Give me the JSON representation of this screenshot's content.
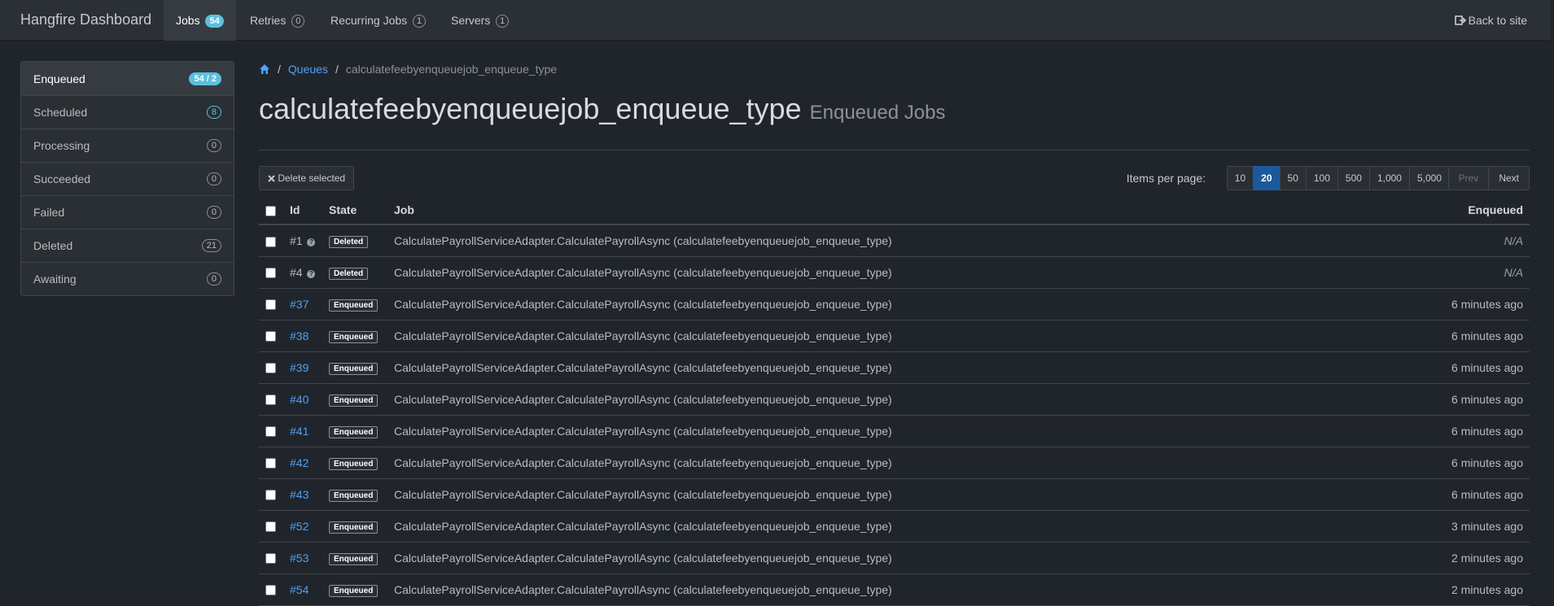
{
  "nav": {
    "brand": "Hangfire Dashboard",
    "items": [
      {
        "label": "Jobs",
        "count": "54"
      },
      {
        "label": "Retries",
        "count": "0"
      },
      {
        "label": "Recurring Jobs",
        "count": "1"
      },
      {
        "label": "Servers",
        "count": "1"
      }
    ],
    "back_label": "Back to site"
  },
  "sidebar": {
    "items": [
      {
        "label": "Enqueued",
        "count": "54 / 2"
      },
      {
        "label": "Scheduled",
        "count": "8"
      },
      {
        "label": "Processing",
        "count": "0"
      },
      {
        "label": "Succeeded",
        "count": "0"
      },
      {
        "label": "Failed",
        "count": "0"
      },
      {
        "label": "Deleted",
        "count": "21"
      },
      {
        "label": "Awaiting",
        "count": "0"
      }
    ]
  },
  "breadcrumb": {
    "queues": "Queues",
    "current": "calculatefeebyenqueuejob_enqueue_type"
  },
  "page": {
    "title": "calculatefeebyenqueuejob_enqueue_type",
    "subtitle": "Enqueued Jobs"
  },
  "toolbar": {
    "delete_label": "Delete selected",
    "items_per_page_label": "Items per page:",
    "page_sizes": [
      "10",
      "20",
      "50",
      "100",
      "500",
      "1,000",
      "5,000"
    ],
    "active_page_size": "20",
    "prev_label": "Prev",
    "next_label": "Next"
  },
  "table": {
    "headers": {
      "id": "Id",
      "state": "State",
      "job": "Job",
      "enqueued": "Enqueued"
    },
    "rows": [
      {
        "id": "#1",
        "state": "Deleted",
        "job": "CalculatePayrollServiceAdapter.CalculatePayrollAsync (calculatefeebyenqueuejob_enqueue_type)",
        "enqueued": "N/A"
      },
      {
        "id": "#4",
        "state": "Deleted",
        "job": "CalculatePayrollServiceAdapter.CalculatePayrollAsync (calculatefeebyenqueuejob_enqueue_type)",
        "enqueued": "N/A"
      },
      {
        "id": "#37",
        "state": "Enqueued",
        "job": "CalculatePayrollServiceAdapter.CalculatePayrollAsync (calculatefeebyenqueuejob_enqueue_type)",
        "enqueued": "6 minutes ago"
      },
      {
        "id": "#38",
        "state": "Enqueued",
        "job": "CalculatePayrollServiceAdapter.CalculatePayrollAsync (calculatefeebyenqueuejob_enqueue_type)",
        "enqueued": "6 minutes ago"
      },
      {
        "id": "#39",
        "state": "Enqueued",
        "job": "CalculatePayrollServiceAdapter.CalculatePayrollAsync (calculatefeebyenqueuejob_enqueue_type)",
        "enqueued": "6 minutes ago"
      },
      {
        "id": "#40",
        "state": "Enqueued",
        "job": "CalculatePayrollServiceAdapter.CalculatePayrollAsync (calculatefeebyenqueuejob_enqueue_type)",
        "enqueued": "6 minutes ago"
      },
      {
        "id": "#41",
        "state": "Enqueued",
        "job": "CalculatePayrollServiceAdapter.CalculatePayrollAsync (calculatefeebyenqueuejob_enqueue_type)",
        "enqueued": "6 minutes ago"
      },
      {
        "id": "#42",
        "state": "Enqueued",
        "job": "CalculatePayrollServiceAdapter.CalculatePayrollAsync (calculatefeebyenqueuejob_enqueue_type)",
        "enqueued": "6 minutes ago"
      },
      {
        "id": "#43",
        "state": "Enqueued",
        "job": "CalculatePayrollServiceAdapter.CalculatePayrollAsync (calculatefeebyenqueuejob_enqueue_type)",
        "enqueued": "6 minutes ago"
      },
      {
        "id": "#52",
        "state": "Enqueued",
        "job": "CalculatePayrollServiceAdapter.CalculatePayrollAsync (calculatefeebyenqueuejob_enqueue_type)",
        "enqueued": "3 minutes ago"
      },
      {
        "id": "#53",
        "state": "Enqueued",
        "job": "CalculatePayrollServiceAdapter.CalculatePayrollAsync (calculatefeebyenqueuejob_enqueue_type)",
        "enqueued": "2 minutes ago"
      },
      {
        "id": "#54",
        "state": "Enqueued",
        "job": "CalculatePayrollServiceAdapter.CalculatePayrollAsync (calculatefeebyenqueuejob_enqueue_type)",
        "enqueued": "2 minutes ago"
      }
    ]
  },
  "colors": {
    "background": "#20252b",
    "navbar": "#2b3035",
    "link": "#4ea1f5",
    "info_badge": "#5bc0de",
    "active_page": "#1b5a9a"
  },
  "icons": {
    "home": "home-icon",
    "back": "sign-out-icon",
    "delete": "times-icon",
    "help": "question-circle-icon"
  }
}
